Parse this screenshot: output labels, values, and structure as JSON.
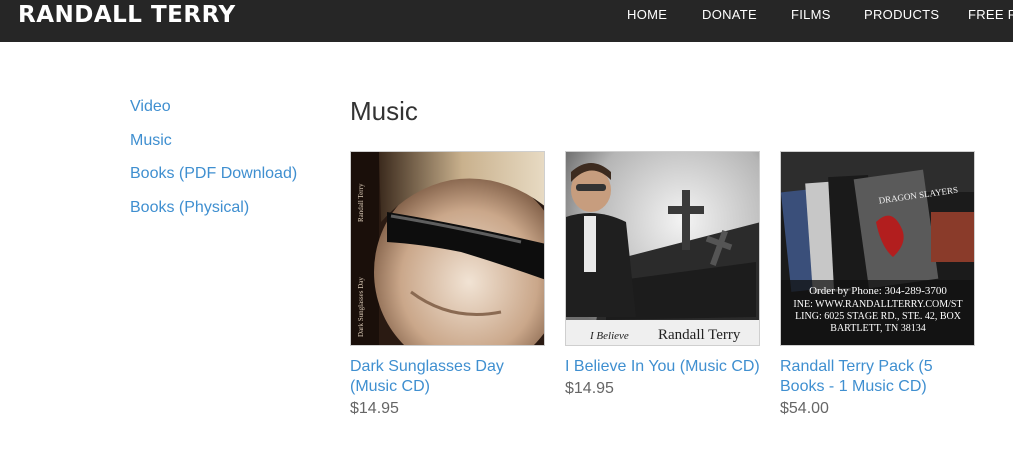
{
  "header": {
    "brand": "RANDALL TERRY",
    "nav": [
      "HOME",
      "DONATE",
      "FILMS",
      "PRODUCTS",
      "FREE RE"
    ]
  },
  "sidebar": {
    "items": [
      "Video",
      "Music",
      "Books (PDF Download)",
      "Books (Physical)"
    ]
  },
  "main": {
    "title": "Music",
    "products": [
      {
        "name": "Dark Sunglasses Day (Music CD)",
        "price": "$14.95",
        "cover_text": [
          "Randall Terry",
          "Dark Sunglasses Day"
        ]
      },
      {
        "name": "I Believe In You (Music CD)",
        "price": "$14.95",
        "cover_text": [
          "I Believe",
          "Randall Terry"
        ]
      },
      {
        "name": "Randall Terry Pack (5 Books - 1 Music CD)",
        "price": "$54.00",
        "cover_text": [
          "DRAGON SLAYERS",
          "Order by Phone: 304-289-3700",
          "INE: WWW.RANDALLTERRY.COM/ST",
          "LING: 6025 STAGE RD., STE. 42, BOX",
          "BARTLETT, TN 38134"
        ]
      }
    ]
  },
  "colors": {
    "topbar_bg": "#262626",
    "link": "#3f8fd0",
    "price": "#666666",
    "title": "#333333"
  }
}
